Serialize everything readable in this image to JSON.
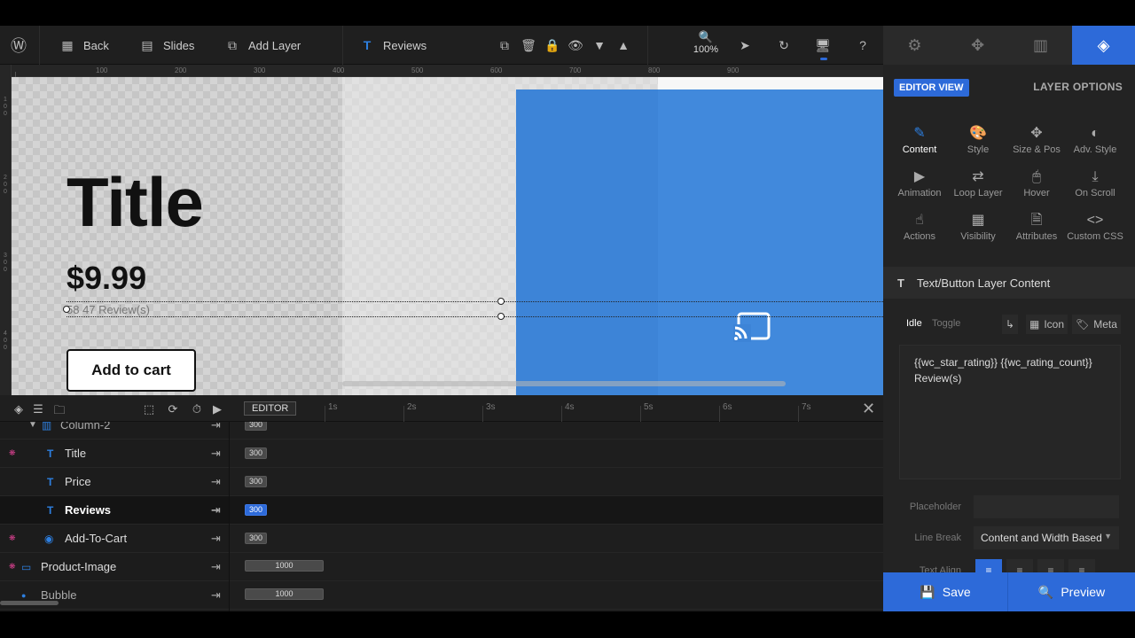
{
  "toolbar": {
    "back_label": "Back",
    "slides_label": "Slides",
    "add_layer_label": "Add Layer",
    "current_layer_label": "Reviews",
    "zoom_level": "100%"
  },
  "ruler": {
    "top_ticks": [
      "100",
      "200",
      "300",
      "400",
      "500",
      "600",
      "700",
      "800",
      "900"
    ],
    "left_ticks": [
      "1 0 0",
      "2 0 0",
      "3 0 0",
      "4 0 0"
    ]
  },
  "canvas": {
    "title": "Title",
    "price": "$9.99",
    "reviews": "58 47 Review(s)",
    "add_to_cart": "Add to cart"
  },
  "timeline": {
    "editor_label": "EDITOR",
    "times": [
      "1s",
      "2s",
      "3s",
      "4s",
      "5s",
      "6s",
      "7s"
    ]
  },
  "layers": [
    {
      "name": "Column-2",
      "duration": "300"
    },
    {
      "name": "Title",
      "duration": "300"
    },
    {
      "name": "Price",
      "duration": "300"
    },
    {
      "name": "Reviews",
      "duration": "300"
    },
    {
      "name": "Add-To-Cart",
      "duration": "300"
    },
    {
      "name": "Product-Image",
      "duration": "1000"
    },
    {
      "name": "Bubble",
      "duration": "1000"
    }
  ],
  "panel": {
    "editor_view": "EDITOR VIEW",
    "layer_options": "LAYER OPTIONS",
    "options": [
      "Content",
      "Style",
      "Size & Pos",
      "Adv. Style",
      "Animation",
      "Loop Layer",
      "Hover",
      "On Scroll",
      "Actions",
      "Visibility",
      "Attributes",
      "Custom CSS"
    ],
    "section_title": "Text/Button Layer Content",
    "tab_idle": "Idle",
    "tab_toggle": "Toggle",
    "icon_label": "Icon",
    "meta_label": "Meta",
    "content_text": "{{wc_star_rating}} {{wc_rating_count}} Review(s)",
    "placeholder_label": "Placeholder",
    "placeholder_value": "",
    "line_break_label": "Line Break",
    "line_break_value": "Content and Width Based",
    "text_align_label": "Text Align"
  },
  "footer": {
    "save_label": "Save",
    "preview_label": "Preview"
  },
  "colors": {
    "accent": "#2d6ad9",
    "canvas_blue": "#3d84d7",
    "dark_bg": "#1f1f1f"
  }
}
